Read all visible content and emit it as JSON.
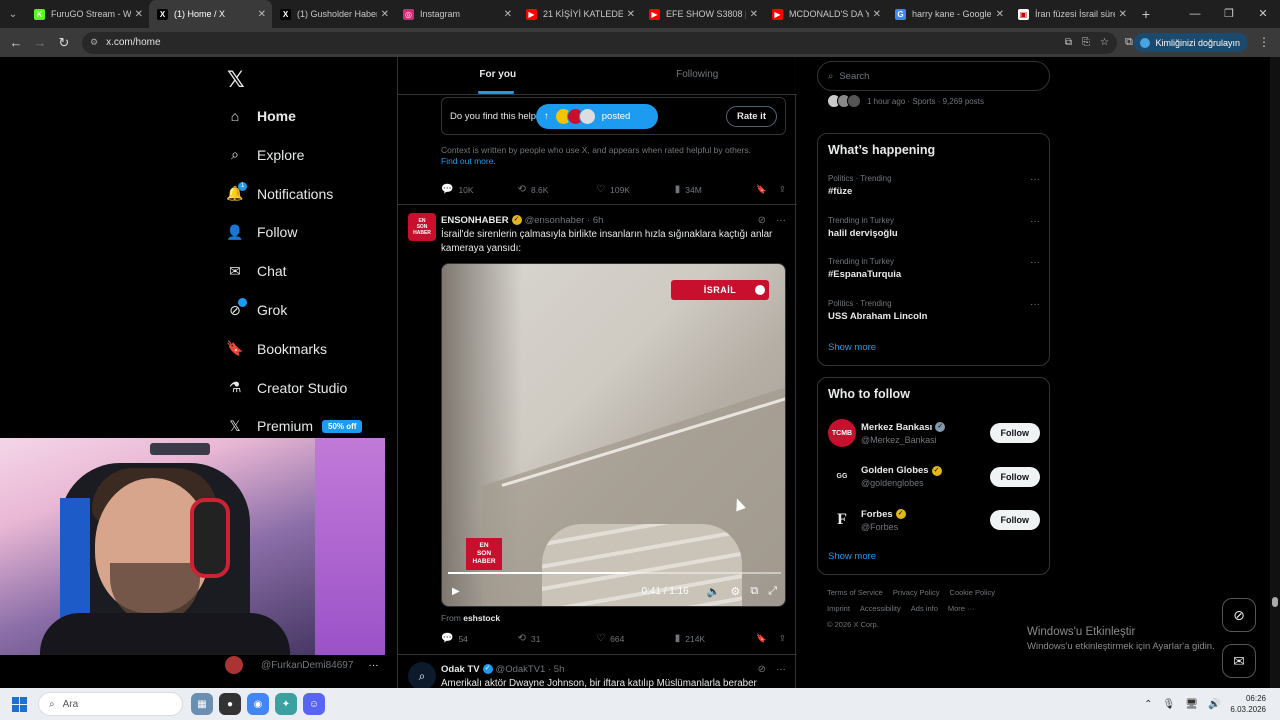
{
  "browser": {
    "tabs": [
      {
        "title": "FuruGO Stream - Wa",
        "fav": "K",
        "color": "#53fc18",
        "active": false
      },
      {
        "title": "(1) Home / X",
        "fav": "X",
        "color": "#000000",
        "active": true
      },
      {
        "title": "(1) Gusholder Haber",
        "fav": "X",
        "color": "#000000",
        "active": false
      },
      {
        "title": "Instagram",
        "fav": "◎",
        "color": "#d62976",
        "active": false
      },
      {
        "title": "21 KİŞİYİ KATLEDEN",
        "fav": "▶",
        "color": "#ff0000",
        "active": false
      },
      {
        "title": "EFE SHOW S3808 | M",
        "fav": "▶",
        "color": "#ff0000",
        "active": false
      },
      {
        "title": "MCDONALD'S DA YA",
        "fav": "▶",
        "color": "#ff0000",
        "active": false
      },
      {
        "title": "harry kane - Google",
        "fav": "G",
        "color": "#4285f4",
        "active": false
      },
      {
        "title": "İran füzesi İsrail süre",
        "fav": "▣",
        "color": "#ffffff",
        "active": false
      }
    ],
    "url": "x.com/home",
    "verify_label": "Kimliğinizi doğrulayın"
  },
  "nav": {
    "items": [
      {
        "label": "Home",
        "icon": "home-icon",
        "glyph": "⌂"
      },
      {
        "label": "Explore",
        "icon": "search-icon",
        "glyph": "⌕"
      },
      {
        "label": "Notifications",
        "icon": "bell-icon",
        "glyph": "🔔",
        "badge": "1"
      },
      {
        "label": "Follow",
        "icon": "person-add-icon",
        "glyph": "👤"
      },
      {
        "label": "Chat",
        "icon": "mail-icon",
        "glyph": "✉"
      },
      {
        "label": "Grok",
        "icon": "grok-icon",
        "glyph": "⊘"
      },
      {
        "label": "Bookmarks",
        "icon": "bookmark-icon",
        "glyph": "🔖"
      },
      {
        "label": "Creator Studio",
        "icon": "flask-icon",
        "glyph": "⚗"
      },
      {
        "label": "Premium",
        "icon": "x-logo-icon",
        "glyph": "𝕏",
        "promo": "50% off"
      }
    ],
    "account_handle": "@FurkanDemi84697"
  },
  "feed": {
    "tabs": [
      "For you",
      "Following"
    ],
    "note_question": "Do you find this help",
    "posted_label": "posted",
    "rate_label": "Rate it",
    "context_text": "Context is written by people who use X, and appears when rated helpful by others.",
    "find_out_more": "Find out more.",
    "post1_stats": {
      "replies": "10K",
      "reposts": "8.6K",
      "likes": "109K",
      "views": "34M"
    },
    "post2": {
      "name": "ENSONHABER",
      "handle": "@ensonhaber",
      "time": "6h",
      "text": "İsrail'de sirenlerin çalmasıyla birlikte insanların hızla sığınaklara kaçtığı anlar kameraya yansıdı:",
      "video_tag": "İSRAİL",
      "logo_lines": [
        "EN",
        "SON",
        "HABER"
      ],
      "time_display": "0:41 / 1:16",
      "progress": 0.54,
      "from_label": "From",
      "from_account": "eshstock",
      "stats": {
        "replies": "54",
        "reposts": "31",
        "likes": "664",
        "views": "214K"
      }
    },
    "post3": {
      "name": "Odak TV",
      "handle": "@OdakTV1",
      "time": "5h",
      "text": "Amerikalı aktör Dwayne Johnson, bir iftara katılıp Müslümanlarla beraber"
    }
  },
  "sidebar": {
    "search_placeholder": "Search",
    "top_meta": "1 hour ago · Sports · 9,269 posts",
    "happening_title": "What’s happening",
    "trends": [
      {
        "cat": "Politics · Trending",
        "title": "#füze"
      },
      {
        "cat": "Trending in Turkey",
        "title": "halil dervişoğlu"
      },
      {
        "cat": "Trending in Turkey",
        "title": "#EspanaTurquia"
      },
      {
        "cat": "Politics · Trending",
        "title": "USS Abraham Lincoln"
      }
    ],
    "show_more": "Show more",
    "who_title": "Who to follow",
    "who": [
      {
        "name": "Merkez Bankası",
        "handle": "@Merkez_Bankasi",
        "ver_color": "#829aab",
        "av_bg": "#c8102e",
        "av_text": "TCMB"
      },
      {
        "name": "Golden Globes",
        "handle": "@goldenglobes",
        "ver_color": "#e2b719",
        "av_bg": "#000000",
        "av_text": "GG"
      },
      {
        "name": "Forbes",
        "handle": "@Forbes",
        "ver_color": "#e2b719",
        "av_bg": "#000000",
        "av_text": "F"
      }
    ],
    "follow_label": "Follow",
    "footer": [
      "Terms of Service",
      "Privacy Policy",
      "Cookie Policy",
      "Imprint",
      "Accessibility",
      "Ads info",
      "More ···",
      "© 2026 X Corp."
    ]
  },
  "windows": {
    "activate_title": "Windows'u Etkinleştir",
    "activate_sub": "Windows'u etkinleştirmek için Ayarlar'a gidin.",
    "search_placeholder": "Ara",
    "time": "06:26",
    "date": "6.03.2026"
  }
}
